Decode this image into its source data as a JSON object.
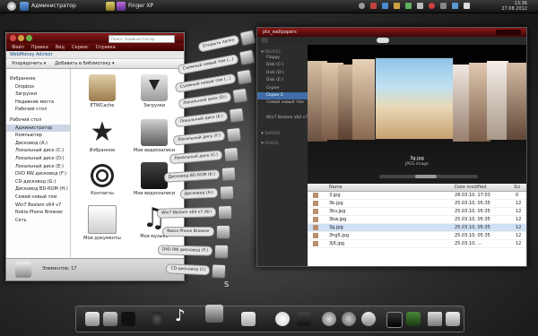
{
  "topbar": {
    "user_label": "Администратор",
    "active_app": "Finger XP",
    "clock_time": "13:36",
    "clock_date": "27.08.2012"
  },
  "explorer": {
    "menu": [
      "Файл",
      "Правка",
      "Вид",
      "Сервис",
      "Справка"
    ],
    "search_placeholder": "Поиск: Администратор",
    "webmoney": "WebMoney Advisor",
    "toolbar": [
      "Упорядочить ▾",
      "Добавить в библиотеку ▾"
    ],
    "nav": [
      {
        "label": "Избранное",
        "group": true
      },
      {
        "label": "Dropbox"
      },
      {
        "label": "Загрузки"
      },
      {
        "label": "Недавние места"
      },
      {
        "label": "Рабочий стол"
      },
      {
        "label": "Рабочий стол",
        "group": true
      },
      {
        "label": "Администратор",
        "sel": true
      },
      {
        "label": "Компьютер"
      },
      {
        "label": "Дисковод (A:)"
      },
      {
        "label": "Локальный диск (C:)"
      },
      {
        "label": "Локальный диск (D:)"
      },
      {
        "label": "Локальный диск (E:)"
      },
      {
        "label": "DVD RW дисковод (F:)"
      },
      {
        "label": "CD-дисковод (G:)"
      },
      {
        "label": "Дисковод BD-ROM (H:)"
      },
      {
        "label": "Семий новый том"
      },
      {
        "label": "Win7 Beslam x64 v7"
      },
      {
        "label": "Nokia Phone Browser"
      },
      {
        "label": "Сеть"
      }
    ],
    "items": [
      {
        "label": "ETWCache"
      },
      {
        "label": "Загрузки"
      },
      {
        "label": "Избранное"
      },
      {
        "label": "Мои видеозаписи"
      },
      {
        "label": "Контакты"
      },
      {
        "label": "Мои видеозаписи"
      },
      {
        "label": "Мои документы"
      },
      {
        "label": "Моя музыка"
      }
    ],
    "status": "Элементов: 17"
  },
  "fan": [
    "Открыть папку",
    "Съемный новый том (...)",
    "Съемный новый том (...)",
    "Локальный диск (D:)",
    "Локальный диск (E:)",
    "Локальный диск (F:)",
    "Локальный диск (C:)",
    "Дисковод BD-ROM (K:)",
    "Дисковод (A:)",
    "Win7 Beslam x64 v7 (N:)",
    "Nokia Phone Browser",
    "DVD RW дисковод (F:)",
    "CD-дисковод (I:)"
  ],
  "gallery": {
    "title": "ptx_wallpapers",
    "side_devices_head": "▼ DEVICES",
    "devices": [
      "Floppy",
      "Disk (C:)",
      "Disk (D:)",
      "Disk (E:)",
      "Скрон",
      "Скрон 2",
      "Семий новый том",
      "",
      "Win7 Beslam x64 v7"
    ],
    "side_shared_head": "▼ SHARED",
    "side_places_head": "▼ PLACES",
    "selected_name": "3g.jpg",
    "selected_type": "JPEG image",
    "columns": [
      "Name",
      "Date modified",
      "Siz"
    ],
    "files": [
      {
        "name": "3.jpg",
        "date": "28.03.10, 17:03",
        "size": "0"
      },
      {
        "name": "3b.jpg",
        "date": "25.03.10, 05:35",
        "size": "12"
      },
      {
        "name": "3bv.jpg",
        "date": "25.03.10, 05:35",
        "size": "12"
      },
      {
        "name": "3bw.jpg",
        "date": "25.03.10, 05:35",
        "size": "12"
      },
      {
        "name": "3g.jpg",
        "date": "25.03.10, 05:35",
        "size": "12"
      },
      {
        "name": "3hg5.jpg",
        "date": "25.03.10, 05:35",
        "size": "12"
      },
      {
        "name": "3j6.jpg",
        "date": "25.03.10, ...",
        "size": "12"
      }
    ]
  },
  "colors": {
    "title_red": "#6a0c0c",
    "selection_blue": "#3f6ea8"
  }
}
